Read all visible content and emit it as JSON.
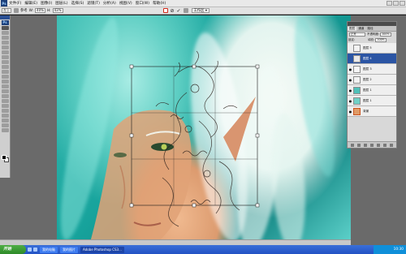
{
  "app": {
    "badge": "Ps"
  },
  "menu": {
    "items": [
      "文件(F)",
      "编辑(E)",
      "图像(I)",
      "图层(L)",
      "选择(S)",
      "滤镜(T)",
      "分析(A)",
      "视图(V)",
      "窗口(W)",
      "帮助(H)"
    ]
  },
  "options_bar": {
    "field1": "左上",
    "label_ref": "参考",
    "label_w": "W:",
    "w_value": "40%",
    "label_h": "H:",
    "h_value": "43%",
    "workspace_label": "工作区 ▾",
    "commit_glyph": "✓",
    "cancel_glyph": "⊘"
  },
  "layers_panel": {
    "tabs": [
      "图层",
      "通道",
      "路径"
    ],
    "blend_mode": "正常",
    "opacity_label": "不透明度:",
    "opacity_value": "100%",
    "lock_label": "锁定:",
    "fill_label": "填充:",
    "fill_value": "100%",
    "layers": [
      {
        "name": "图层 5",
        "selected": false,
        "visible": false
      },
      {
        "name": "图层 4",
        "selected": true,
        "visible": false
      },
      {
        "name": "图层 3",
        "selected": false,
        "visible": true
      },
      {
        "name": "图层 2",
        "selected": false,
        "visible": true
      },
      {
        "name": "图层 1",
        "selected": false,
        "visible": true
      },
      {
        "name": "图层 1",
        "selected": false,
        "visible": true
      },
      {
        "name": "背景",
        "selected": false,
        "visible": true
      }
    ]
  },
  "taskbar": {
    "start_label": "开始",
    "tasks": [
      "我的电脑",
      "我的图片",
      "Adobe Photoshop CS3..."
    ],
    "clock": "10:30"
  },
  "colors": {
    "teal_bg": "#17a39c",
    "hair": "#e9f6f1",
    "skin": "#dc9b6f",
    "selection_blue": "#2b55a4"
  }
}
